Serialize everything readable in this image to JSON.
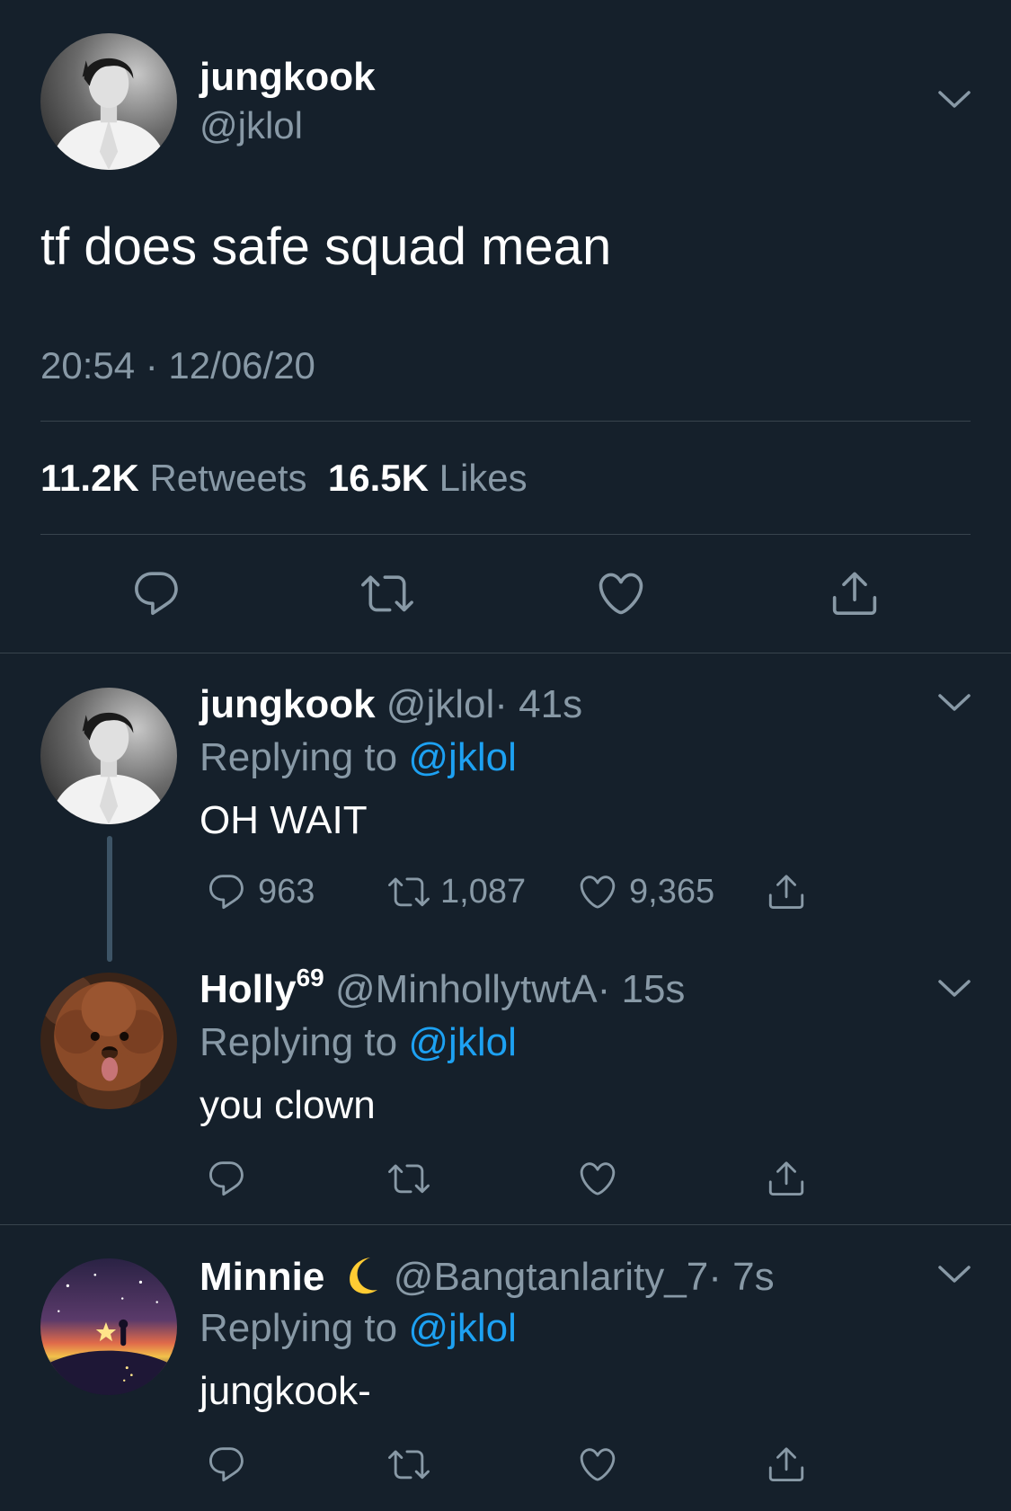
{
  "main_tweet": {
    "name": "jungkook",
    "handle": "@jklol",
    "text": "tf does safe squad mean",
    "timestamp": "20:54 · 12/06/20",
    "retweets_count": "11.2K",
    "retweets_label": "Retweets",
    "likes_count": "16.5K",
    "likes_label": "Likes"
  },
  "replies": [
    {
      "name": "jungkook",
      "name_sup": "",
      "handle": "@jklol",
      "time": "· 41s",
      "replying_prefix": "Replying to",
      "replying_to": "@jklol",
      "text": "OH WAIT",
      "reply_count": "963",
      "retweet_count": "1,087",
      "like_count": "9,365"
    },
    {
      "name": "Holly",
      "name_sup": "69",
      "handle": "@MinhollytwtA",
      "time": "· 15s",
      "replying_prefix": "Replying to",
      "replying_to": "@jklol",
      "text": "you clown",
      "reply_count": "",
      "retweet_count": "",
      "like_count": ""
    },
    {
      "name": "Minnie",
      "name_emoji": "crescent-moon-emoji",
      "handle": "@Bangtanlarity_7",
      "time": "· 7s",
      "replying_prefix": "Replying to",
      "replying_to": "@jklol",
      "text": "jungkook-",
      "reply_count": "",
      "retweet_count": "",
      "like_count": ""
    }
  ],
  "icons": {
    "reply": "reply-icon",
    "retweet": "retweet-icon",
    "like": "heart-icon",
    "share": "share-icon",
    "more": "chevron-down-icon"
  },
  "colors": {
    "background": "#15202b",
    "text": "#ffffff",
    "muted": "#8899a6",
    "link": "#1da1f2",
    "divider": "#38444d"
  }
}
